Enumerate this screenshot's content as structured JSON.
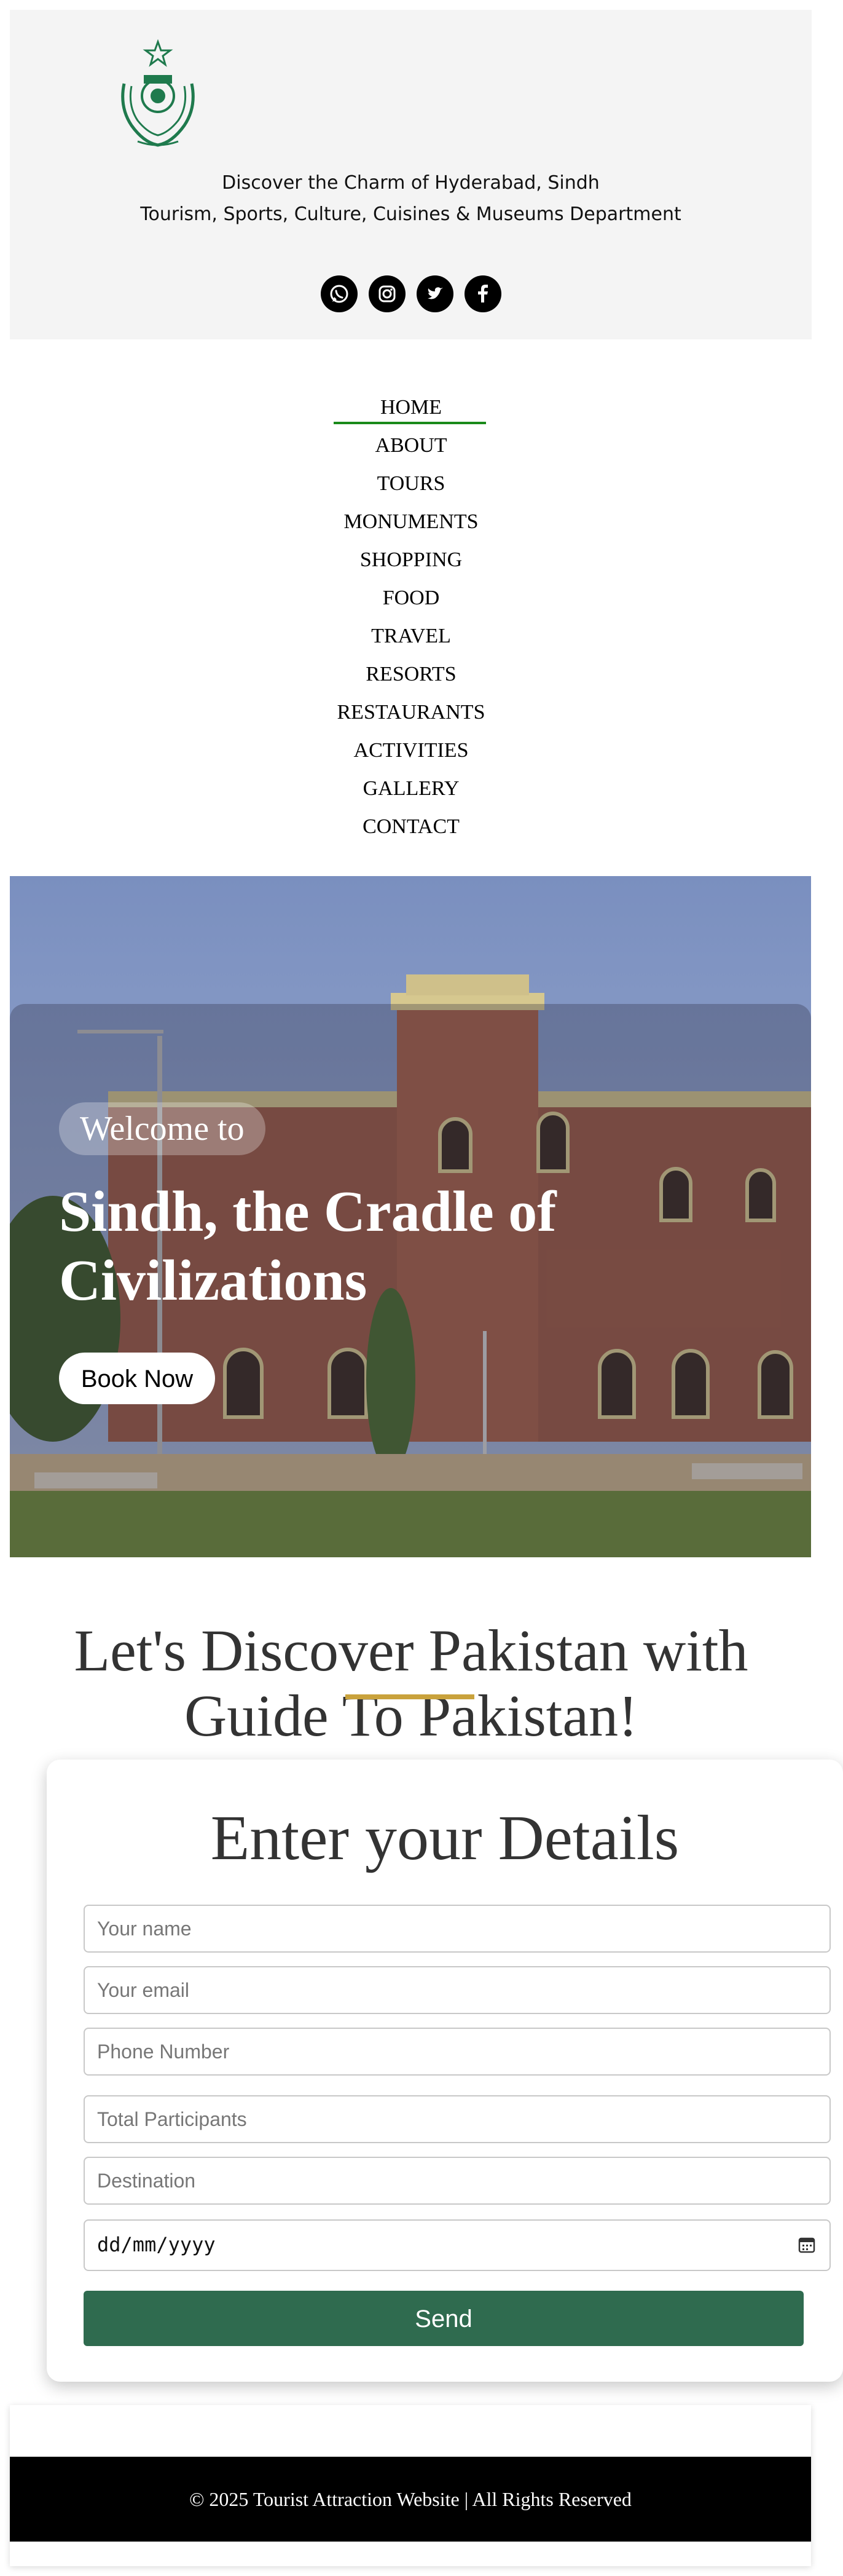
{
  "header": {
    "tagline_line1": "Discover the Charm of Hyderabad, Sindh",
    "tagline_line2": "Tourism, Sports, Culture, Cuisines & Museums Department",
    "logo_icon": "sindh-government-emblem",
    "social_icons": [
      "whatsapp-icon",
      "instagram-icon",
      "twitter-icon",
      "facebook-icon"
    ]
  },
  "nav": {
    "items": [
      "HOME",
      "ABOUT",
      "TOURS",
      "MONUMENTS",
      "SHOPPING",
      "FOOD",
      "TRAVEL",
      "RESORTS",
      "RESTAURANTS",
      "ACTIVITIES",
      "GALLERY",
      "CONTACT"
    ],
    "active": "HOME",
    "active_color": "#1a8a1a"
  },
  "hero": {
    "welcome": "Welcome to",
    "title_line1": "Sindh, the Cradle of",
    "title_line2": "Civilizations",
    "book_button": "Book Now"
  },
  "discover": {
    "line1": "Let's Discover Pakistan with",
    "line2": "Guide To Pakistan!",
    "accent_color": "#c9a23c"
  },
  "form": {
    "title": "Enter your Details",
    "name_placeholder": "Your name",
    "email_placeholder": "Your email",
    "phone_placeholder": "Phone Number",
    "participants_placeholder": "Total Participants",
    "destination_placeholder": "Destination",
    "date_placeholder": "dd/mm/yyyy",
    "send_button": "Send",
    "button_color": "#2f6b4f"
  },
  "footer": {
    "text": "© 2025 Tourist Attraction Website | All Rights Reserved"
  }
}
